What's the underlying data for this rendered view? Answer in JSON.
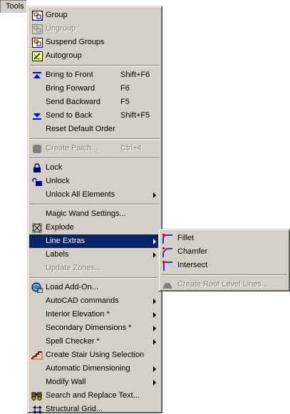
{
  "menubar": {
    "tools_label": "Tools"
  },
  "main_menu": {
    "group": "Group",
    "ungroup": "Ungroup",
    "suspend_groups": "Suspend Groups",
    "autogroup": "Autogroup",
    "bring_to_front": "Bring to Front",
    "bring_to_front_shortcut": "Shift+F6",
    "bring_forward": "Bring Forward",
    "bring_forward_shortcut": "F6",
    "send_backward": "Send Backward",
    "send_backward_shortcut": "F5",
    "send_to_back": "Send to Back",
    "send_to_back_shortcut": "Shift+F5",
    "reset_default_order": "Reset Default Order",
    "create_patch": "Create Patch...",
    "create_patch_shortcut": "Ctrl+4",
    "lock": "Lock",
    "unlock": "Unlock",
    "unlock_all_elements": "Unlock All Elements",
    "magic_wand_settings": "Magic Wand Settings...",
    "explode": "Explode",
    "line_extras": "Line Extras",
    "labels": "Labels",
    "update_zones": "Update Zones...",
    "load_add_on": "Load Add-On...",
    "autocad_commands": "AutoCAD commands",
    "interior_elevation": "Interior Elevation *",
    "secondary_dimensions": "Secondary Dimensions *",
    "spell_checker": "Spell Checker *",
    "create_stair": "Create Stair Using Selection",
    "automatic_dimensioning": "Automatic Dimensioning",
    "modify_wall": "Modify Wall",
    "search_replace": "Search and Replace Text...",
    "structural_grid": "Structural Grid..."
  },
  "sub_menu": {
    "fillet": "Fillet",
    "chamfer": "Chamfer",
    "intersect": "Intersect",
    "create_roof_level_lines": "Create Roof Level Lines..."
  },
  "colors": {
    "menu_bg": "#d4d0c8",
    "highlight": "#0a246a",
    "disabled_text": "#808080"
  },
  "icons": [
    "group-icon",
    "ungroup-icon",
    "suspend-groups-icon",
    "autogroup-icon",
    "bring-to-front-icon",
    "send-to-back-icon",
    "create-patch-icon",
    "lock-icon",
    "unlock-icon",
    "explode-icon",
    "load-add-on-icon",
    "stair-icon",
    "binoculars-icon",
    "grid-icon",
    "fillet-icon",
    "chamfer-icon",
    "intersect-icon",
    "roof-icon"
  ]
}
